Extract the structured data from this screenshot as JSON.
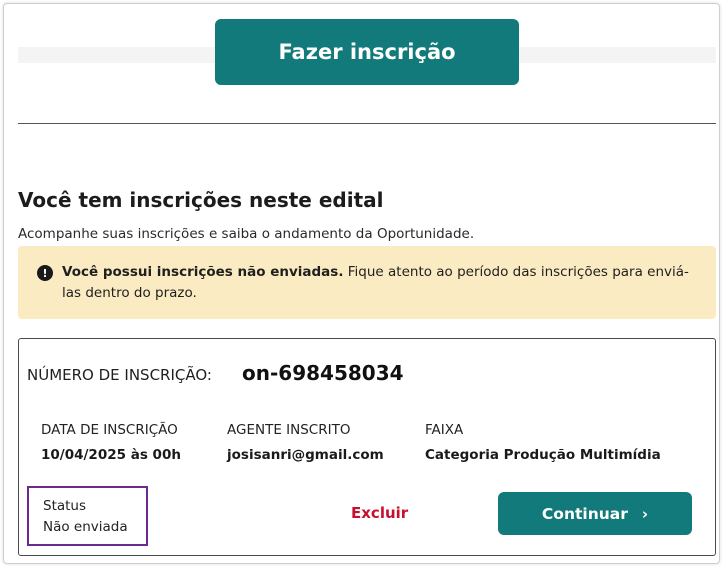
{
  "header": {
    "cta_label": "Fazer inscrição"
  },
  "section": {
    "title": "Você tem inscrições neste edital",
    "subtitle": "Acompanhe suas inscrições e saiba o andamento da Oportunidade."
  },
  "alert": {
    "icon": "exclamation-circle-icon",
    "bold_text": "Você possui inscrições não enviadas.",
    "text": " Fique atento ao período das inscrições para enviá-las dentro do prazo."
  },
  "registration": {
    "number_label": "NÚMERO DE INSCRIÇÃO:",
    "number_value": "on-698458034",
    "date_label": "DATA DE INSCRIÇÃO",
    "date_value": "10/04/2025 às 00h",
    "agent_label": "AGENTE INSCRITO",
    "agent_value": "josisanri@gmail.com",
    "range_label": "FAIXA",
    "range_value": "Categoria Produção Multimídia",
    "status_label": "Status",
    "status_value": "Não enviada",
    "delete_label": "Excluir",
    "continue_label": "Continuar"
  },
  "colors": {
    "primary": "#127a7a",
    "alert_bg": "#fbebc2",
    "danger": "#c8102e",
    "highlight_border": "#6b2a8f"
  }
}
